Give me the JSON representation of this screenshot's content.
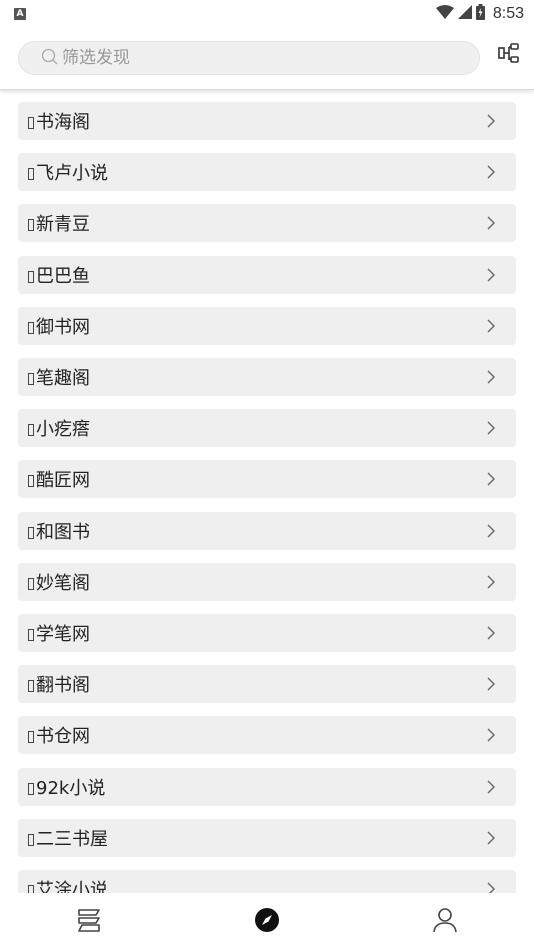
{
  "status_bar": {
    "left_badge": "A",
    "time": "8:53",
    "icons": [
      "wifi-icon",
      "signal-icon",
      "battery-icon"
    ]
  },
  "search": {
    "value": "",
    "placeholder": "筛选发现"
  },
  "header_action_icon": "group-toggle-icon",
  "list": {
    "items": [
      {
        "label": "书海阁"
      },
      {
        "label": "飞卢小说"
      },
      {
        "label": "新青豆"
      },
      {
        "label": "巴巴鱼"
      },
      {
        "label": "御书网"
      },
      {
        "label": "笔趣阁"
      },
      {
        "label": "小疙瘩"
      },
      {
        "label": "酷匠网"
      },
      {
        "label": "和图书"
      },
      {
        "label": "妙笔阁"
      },
      {
        "label": "学笔网"
      },
      {
        "label": "翻书阁"
      },
      {
        "label": "书仓网"
      },
      {
        "label": "92k小说"
      },
      {
        "label": "二三书屋"
      },
      {
        "label": "艾涂小说"
      }
    ]
  },
  "bottom_nav": {
    "items": [
      {
        "icon": "bookshelf-icon",
        "active": false
      },
      {
        "icon": "compass-icon",
        "active": true
      },
      {
        "icon": "profile-icon",
        "active": false
      }
    ]
  },
  "colors": {
    "item_background": "#efefef",
    "search_background": "#f0f0f0",
    "text": "#222222",
    "active_nav": "#111111",
    "inactive_nav": "#555555"
  }
}
